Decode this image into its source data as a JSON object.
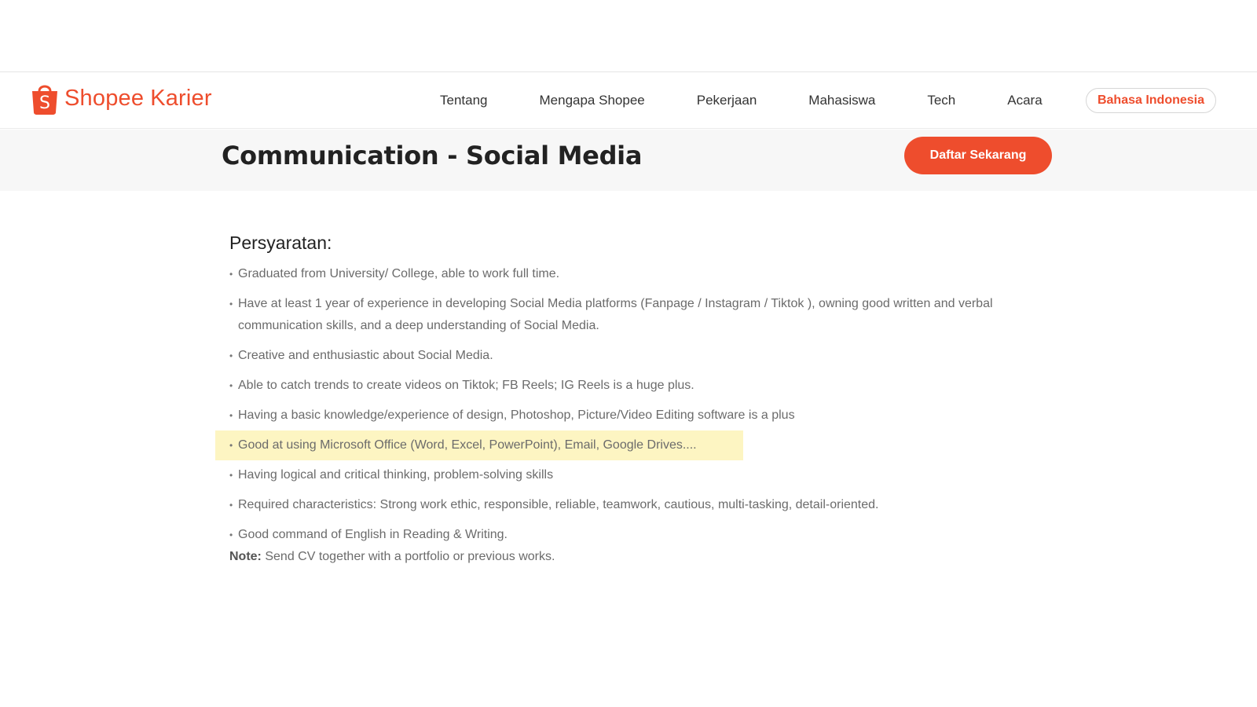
{
  "brand": {
    "logo_text_1": "Shopee",
    "logo_text_2": "Karier",
    "accent_color": "#ee4d2d",
    "logo_icon": "shopee-bag-icon"
  },
  "nav": {
    "items": [
      {
        "label": "Tentang"
      },
      {
        "label": "Mengapa Shopee"
      },
      {
        "label": "Pekerjaan"
      },
      {
        "label": "Mahasiswa"
      },
      {
        "label": "Tech"
      },
      {
        "label": "Acara"
      }
    ],
    "language_label": "Bahasa Indonesia"
  },
  "job": {
    "title": "Communication - Social Media",
    "apply_label": "Daftar Sekarang"
  },
  "requirements": {
    "heading": "Persyaratan:",
    "items": [
      "Graduated from University/ College, able to work full time.",
      "Have at least 1 year of experience in developing Social Media platforms (Fanpage / Instagram / Tiktok ), owning good written and verbal communication skills, and a deep understanding of Social Media.",
      "Creative and enthusiastic about Social Media.",
      "Able to catch trends to create videos on Tiktok; FB Reels; IG Reels is a huge plus.",
      "Having a basic knowledge/experience of design, Photoshop, Picture/Video Editing software is a plus",
      "Good at using Microsoft Office (Word, Excel, PowerPoint), Email, Google Drives....",
      "Having logical and critical thinking, problem-solving skills",
      "Required characteristics: Strong work ethic, responsible, reliable, teamwork, cautious, multi-tasking, detail-oriented.",
      "Good command of English in Reading & Writing."
    ],
    "bullet": "•",
    "highlight_color": "#fdf5c2",
    "note_label": "Note:",
    "note_text": "Send CV together with a portfolio or previous works."
  }
}
